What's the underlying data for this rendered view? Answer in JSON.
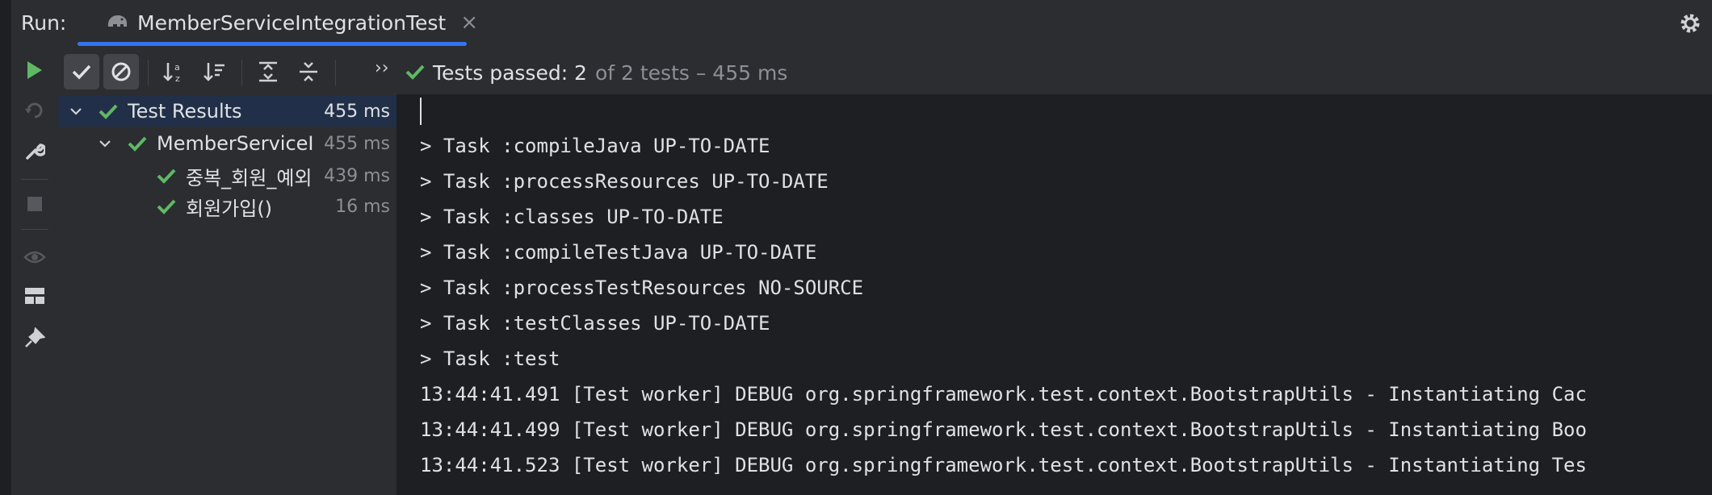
{
  "header": {
    "run_label": "Run:",
    "tab_title": "MemberServiceIntegrationTest",
    "tab_close": "×"
  },
  "toolbar": {
    "status_passed": "Tests passed: 2",
    "status_rest": "of 2 tests – 455 ms",
    "expand_more": "››"
  },
  "tree": {
    "rows": [
      {
        "name": "Test Results",
        "time": "455 ms"
      },
      {
        "name": "MemberServiceI",
        "time": "455 ms"
      },
      {
        "name": "중복_회원_예외",
        "time": "439 ms"
      },
      {
        "name": "회원가입()",
        "time": "16 ms"
      }
    ]
  },
  "console": {
    "lines": [
      "> Task :compileJava UP-TO-DATE",
      "> Task :processResources UP-TO-DATE",
      "> Task :classes UP-TO-DATE",
      "> Task :compileTestJava UP-TO-DATE",
      "> Task :processTestResources NO-SOURCE",
      "> Task :testClasses UP-TO-DATE",
      "> Task :test",
      "13:44:41.491 [Test worker] DEBUG org.springframework.test.context.BootstrapUtils - Instantiating Cac",
      "13:44:41.499 [Test worker] DEBUG org.springframework.test.context.BootstrapUtils - Instantiating Boo",
      "13:44:41.523 [Test worker] DEBUG org.springframework.test.context.BootstrapUtils - Instantiating Tes"
    ]
  },
  "colors": {
    "accent": "#3574f0",
    "success": "#5fb865",
    "background": "#2b2d30",
    "console_bg": "#1e1f22",
    "selection": "#213048"
  },
  "icons": {
    "tab": "gradle-elephant-icon",
    "settings": "gear-icon",
    "run": "play-icon",
    "rerun_failed": "rerun-failed-icon",
    "toggle_tool": "wrench-icon",
    "stop": "stop-icon",
    "show_ignored": "eye-icon",
    "layout": "layout-icon",
    "pin": "pin-icon",
    "show_passed": "check-icon",
    "show_ignored_filter": "cancel-circle-icon",
    "sort_alpha": "sort-alphabetically-icon",
    "sort_duration": "sort-by-duration-icon",
    "expand_all": "expand-all-icon",
    "collapse_all": "collapse-all-icon",
    "status_ok": "check-icon"
  }
}
